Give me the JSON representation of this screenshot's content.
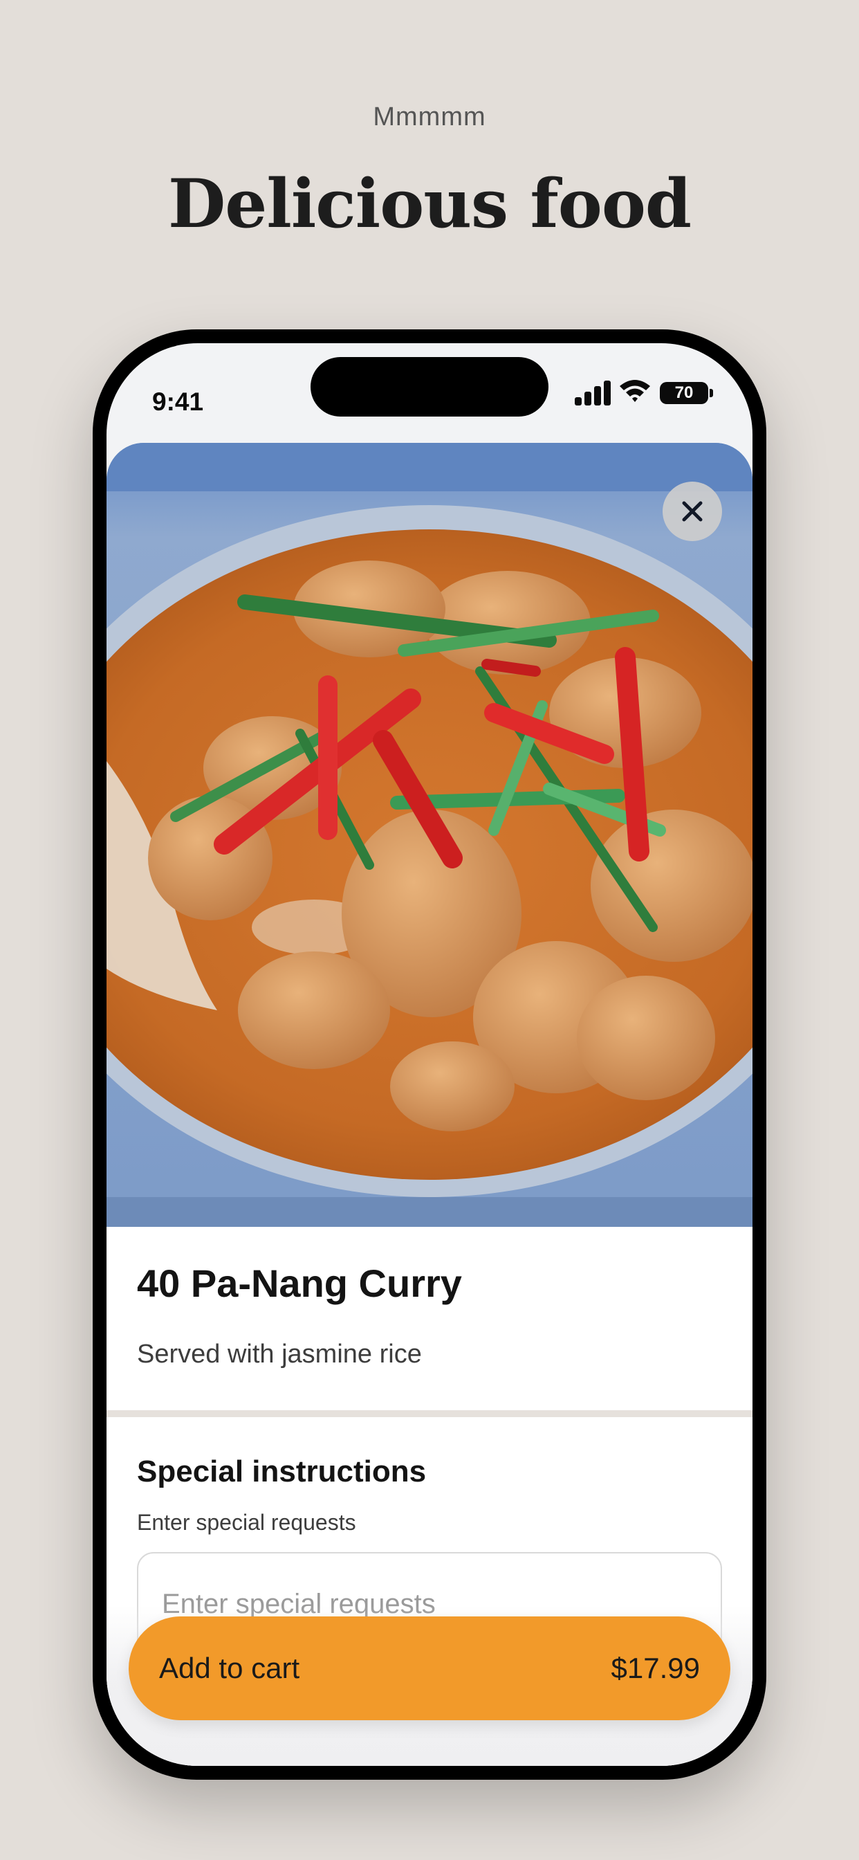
{
  "hero": {
    "eyebrow": "Mmmmm",
    "headline": "Delicious food"
  },
  "status_bar": {
    "time": "9:41",
    "battery": "70",
    "icons": [
      "signal-icon",
      "wifi-icon",
      "battery-icon"
    ]
  },
  "item": {
    "image": "pa-nang-curry-photo",
    "title": "40 Pa-Nang Curry",
    "description": "Served with jasmine rice"
  },
  "instructions": {
    "title": "Special instructions",
    "label": "Enter special requests",
    "placeholder": "Enter special requests",
    "value": ""
  },
  "cart": {
    "label": "Add to cart",
    "price": "$17.99"
  },
  "colors": {
    "background": "#e3ded9",
    "accent": "#f29a2a",
    "text": "#141414"
  }
}
